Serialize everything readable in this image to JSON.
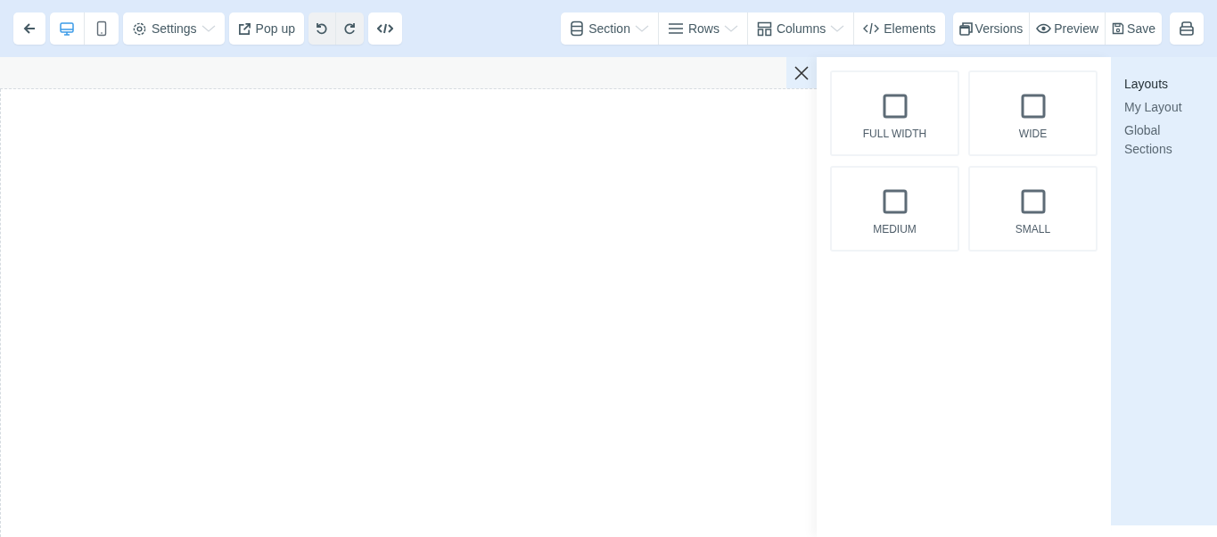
{
  "toolbar": {
    "devices": [
      {
        "kind": "desktop",
        "selected": true
      },
      {
        "kind": "mobile",
        "selected": false
      }
    ],
    "settings": {
      "label": "Settings"
    },
    "popup": {
      "label": "Pop up"
    },
    "structure": [
      {
        "kind": "section",
        "label": "Section",
        "dropdown": true
      },
      {
        "kind": "rows",
        "label": "Rows",
        "dropdown": true
      },
      {
        "kind": "columns",
        "label": "Columns",
        "dropdown": true
      },
      {
        "kind": "elements",
        "label": "Elements",
        "dropdown": false
      }
    ],
    "actions": [
      {
        "kind": "versions",
        "label": "Versions"
      },
      {
        "kind": "preview",
        "label": "Preview"
      },
      {
        "kind": "save",
        "label": "Save"
      }
    ]
  },
  "layouts": [
    {
      "label": "FULL WIDTH"
    },
    {
      "label": "WIDE"
    },
    {
      "label": "MEDIUM"
    },
    {
      "label": "SMALL"
    }
  ],
  "sidebar": {
    "items": [
      {
        "label": "Layouts",
        "selected": true
      },
      {
        "label": "My Layout",
        "selected": false
      },
      {
        "label": "Global Sections",
        "selected": false
      }
    ]
  }
}
